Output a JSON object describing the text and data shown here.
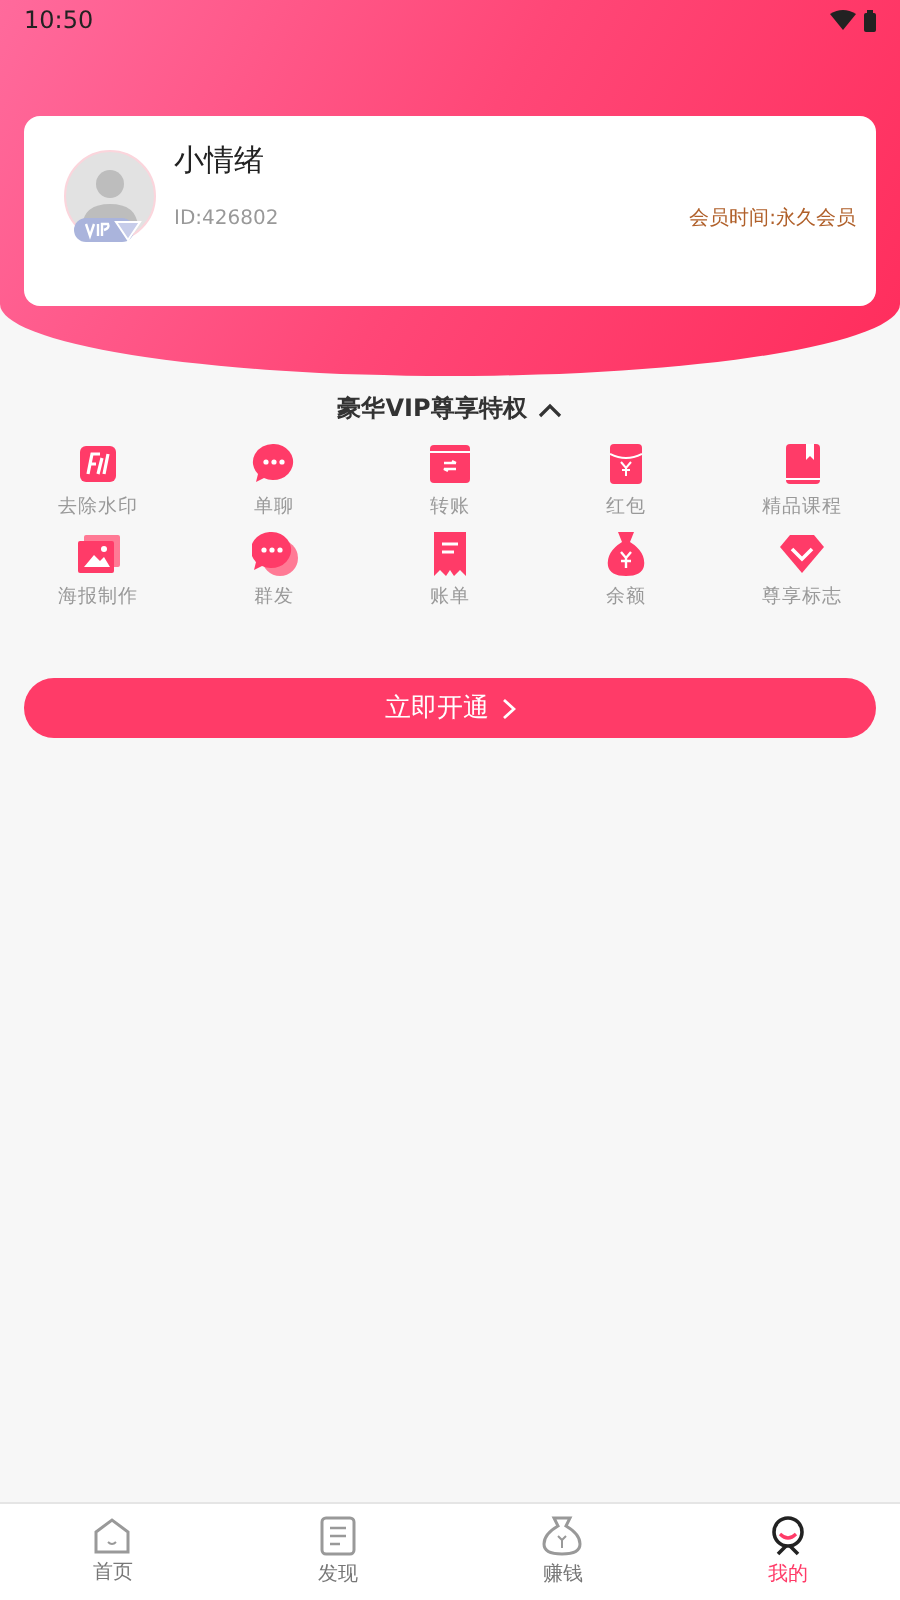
{
  "status_bar": {
    "time": "10:50"
  },
  "profile": {
    "name": "小情绪",
    "id": "ID:426802",
    "membership": "会员时间:永久会员"
  },
  "privileges": {
    "title": "豪华VIP尊享特权",
    "expanded": true,
    "items": [
      {
        "label": "去除水印"
      },
      {
        "label": "单聊"
      },
      {
        "label": "转账"
      },
      {
        "label": "红包"
      },
      {
        "label": "精品课程"
      },
      {
        "label": "海报制作"
      },
      {
        "label": "群发"
      },
      {
        "label": "账单"
      },
      {
        "label": "余额"
      },
      {
        "label": "尊享标志"
      }
    ]
  },
  "open_button": {
    "label": "立即开通"
  },
  "bottom_nav": [
    {
      "label": "首页",
      "selected": false
    },
    {
      "label": "发现",
      "selected": false
    },
    {
      "label": "赚钱",
      "selected": false
    },
    {
      "label": "我的",
      "selected": true
    }
  ]
}
